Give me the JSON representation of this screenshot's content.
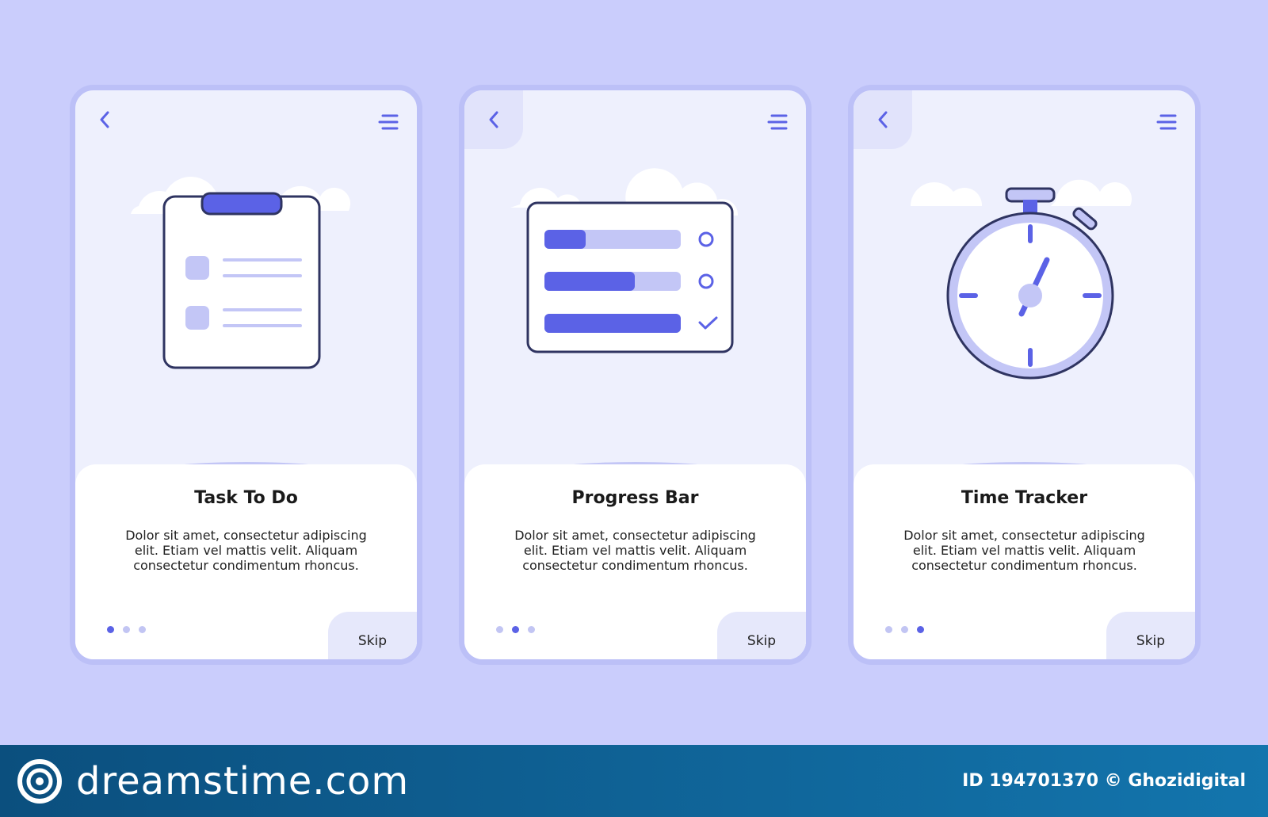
{
  "colors": {
    "background": "#cacdfc",
    "screen": "#eef0fd",
    "accent": "#5b62e6",
    "accent_light": "#c3c6f6",
    "outline": "#2f3461",
    "footer": "#0b4f7e"
  },
  "screens": [
    {
      "title": "Task To Do",
      "description": "Dolor sit amet, consectetur adipiscing elit. Etiam vel mattis velit. Aliquam consectetur condimentum rhoncus.",
      "skip_label": "Skip",
      "active_dot": 1,
      "icon": "clipboard-checklist-icon"
    },
    {
      "title": "Progress Bar",
      "description": "Dolor sit amet, consectetur adipiscing elit. Etiam vel mattis velit. Aliquam consectetur condimentum rhoncus.",
      "skip_label": "Skip",
      "active_dot": 2,
      "icon": "progress-bars-icon",
      "progress": [
        0.3,
        0.66,
        1.0
      ]
    },
    {
      "title": "Time Tracker",
      "description": "Dolor sit amet, consectetur adipiscing elit. Etiam vel mattis velit. Aliquam consectetur condimentum rhoncus.",
      "skip_label": "Skip",
      "active_dot": 3,
      "icon": "stopwatch-icon"
    }
  ],
  "footer": {
    "logo_text": "dreamstime.com",
    "image_id": "ID 194701370 © Ghozidigital"
  }
}
